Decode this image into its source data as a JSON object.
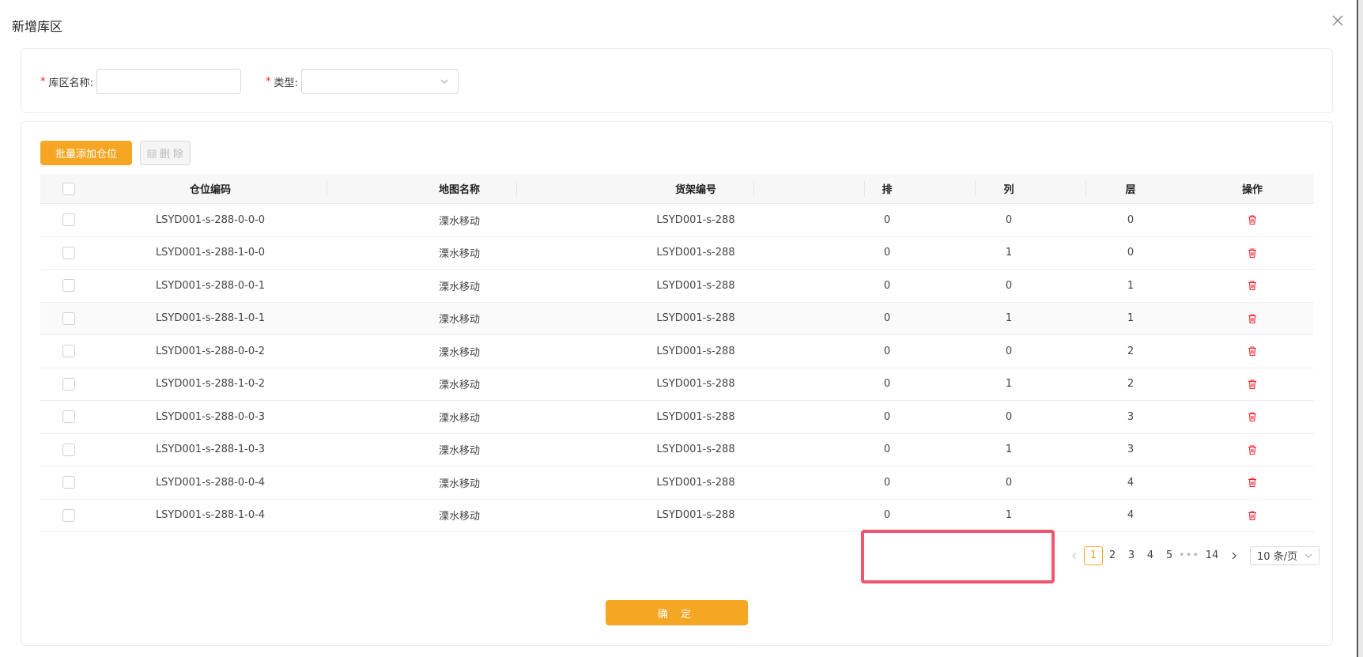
{
  "dialog": {
    "title": "新增库区"
  },
  "form": {
    "name_label": "库区名称:",
    "name_value": "",
    "type_label": "类型:",
    "type_value": ""
  },
  "toolbar": {
    "batch_add_label": "批量添加仓位",
    "delete_label": "删 除"
  },
  "table": {
    "headers": [
      "仓位编码",
      "地图名称",
      "货架编号",
      "排",
      "列",
      "层",
      "操作"
    ],
    "rows": [
      [
        "LSYD001-s-288-0-0-0",
        "溧水移动",
        "LSYD001-s-288",
        "0",
        "0",
        "0"
      ],
      [
        "LSYD001-s-288-1-0-0",
        "溧水移动",
        "LSYD001-s-288",
        "0",
        "1",
        "0"
      ],
      [
        "LSYD001-s-288-0-0-1",
        "溧水移动",
        "LSYD001-s-288",
        "0",
        "0",
        "1"
      ],
      [
        "LSYD001-s-288-1-0-1",
        "溧水移动",
        "LSYD001-s-288",
        "0",
        "1",
        "1"
      ],
      [
        "LSYD001-s-288-0-0-2",
        "溧水移动",
        "LSYD001-s-288",
        "0",
        "0",
        "2"
      ],
      [
        "LSYD001-s-288-1-0-2",
        "溧水移动",
        "LSYD001-s-288",
        "0",
        "1",
        "2"
      ],
      [
        "LSYD001-s-288-0-0-3",
        "溧水移动",
        "LSYD001-s-288",
        "0",
        "0",
        "3"
      ],
      [
        "LSYD001-s-288-1-0-3",
        "溧水移动",
        "LSYD001-s-288",
        "0",
        "1",
        "3"
      ],
      [
        "LSYD001-s-288-0-0-4",
        "溧水移动",
        "LSYD001-s-288",
        "0",
        "0",
        "4"
      ],
      [
        "LSYD001-s-288-1-0-4",
        "溧水移动",
        "LSYD001-s-288",
        "0",
        "1",
        "4"
      ]
    ]
  },
  "pagination": {
    "pages": [
      "1",
      "2",
      "3",
      "4",
      "5"
    ],
    "ellipsis": "•••",
    "last_page": "14",
    "current": "1",
    "page_size": "10 条/页"
  },
  "footer": {
    "confirm_label": "确 定"
  },
  "colors": {
    "primary": "#f5a623",
    "danger": "#f5222d",
    "highlight": "#f0566e"
  },
  "icons": {
    "close": "close-icon",
    "chevron": "chevron-down-icon",
    "trash": "trash-icon",
    "prev": "chevron-left-icon",
    "next": "chevron-right-icon"
  }
}
